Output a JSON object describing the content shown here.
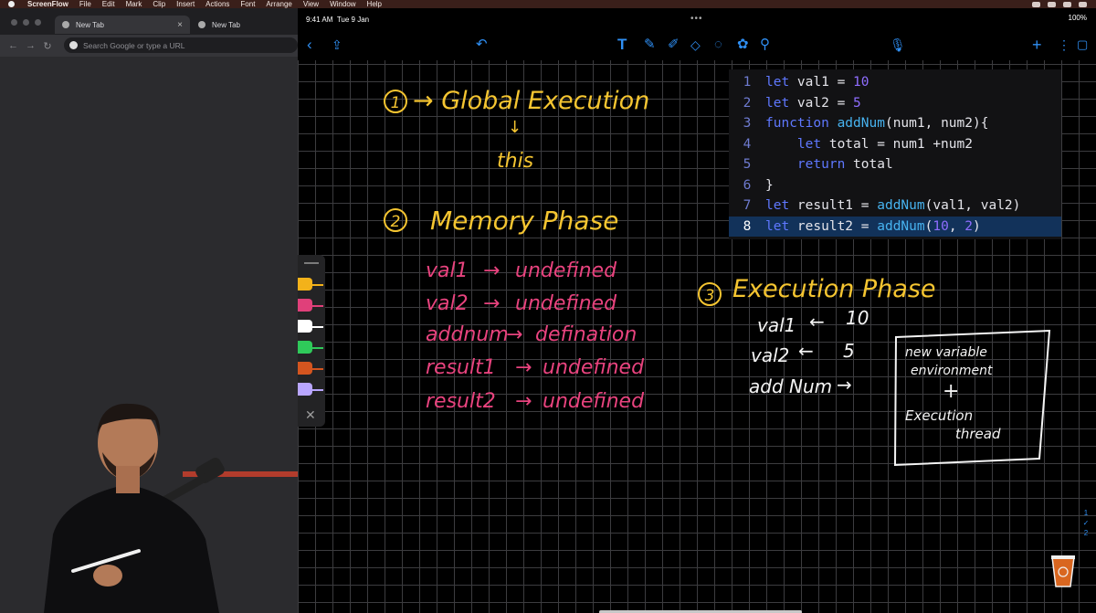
{
  "menubar": {
    "app": "ScreenFlow",
    "items": [
      "File",
      "Edit",
      "Mark",
      "Clip",
      "Insert",
      "Actions",
      "Font",
      "Arrange",
      "View",
      "Window",
      "Help"
    ]
  },
  "browser": {
    "tabs": [
      {
        "label": "New Tab"
      },
      {
        "label": "New Tab"
      }
    ],
    "address_placeholder": "Search Google or type a URL"
  },
  "ipad": {
    "time": "9:41 AM",
    "date": "Tue 9 Jan",
    "battery": "100%",
    "toolbar_icons": [
      "back-icon",
      "share-icon",
      "undo-icon",
      "text-tool-icon",
      "pen-icon",
      "highlighter-icon",
      "eraser-icon",
      "lasso-icon",
      "shapes-icon",
      "color-picker-icon",
      "microphone-icon",
      "add-icon",
      "more-icon",
      "pages-icon"
    ],
    "accent": "#2f8ff4"
  },
  "code": {
    "lines": [
      {
        "n": "1",
        "tokens": [
          [
            "kw",
            "let "
          ],
          [
            "pl",
            "val1 = "
          ],
          [
            "num",
            "10"
          ]
        ]
      },
      {
        "n": "2",
        "tokens": [
          [
            "kw",
            "let "
          ],
          [
            "pl",
            "val2 = "
          ],
          [
            "num",
            "5"
          ]
        ]
      },
      {
        "n": "3",
        "tokens": [
          [
            "kw",
            "function "
          ],
          [
            "fn",
            "addNum"
          ],
          [
            "pl",
            "(num1, num2){"
          ]
        ]
      },
      {
        "n": "4",
        "tokens": [
          [
            "pl",
            "    "
          ],
          [
            "kw",
            "let "
          ],
          [
            "pl",
            "total = num1 +num2"
          ]
        ]
      },
      {
        "n": "5",
        "tokens": [
          [
            "pl",
            "    "
          ],
          [
            "kw",
            "return "
          ],
          [
            "pl",
            "total"
          ]
        ]
      },
      {
        "n": "6",
        "tokens": [
          [
            "pl",
            "}"
          ]
        ]
      },
      {
        "n": "7",
        "tokens": [
          [
            "kw",
            "let "
          ],
          [
            "pl",
            "result1 = "
          ],
          [
            "fn",
            "addNum"
          ],
          [
            "pl",
            "(val1, val2)"
          ]
        ]
      },
      {
        "n": "8",
        "tokens": [
          [
            "kw",
            "let "
          ],
          [
            "pl",
            "result2 = "
          ],
          [
            "fn",
            "addNum"
          ],
          [
            "pl",
            "("
          ],
          [
            "num",
            "10"
          ],
          [
            "pl",
            ", "
          ],
          [
            "num",
            "2"
          ],
          [
            "pl",
            ")"
          ]
        ]
      }
    ],
    "active_line": 8
  },
  "notes": {
    "step1_num": "1",
    "step1_title": "→ Global Execution",
    "step1_arrow": "↓",
    "step1_this": "this",
    "step2_num": "2",
    "step2_title": "Memory Phase",
    "memory": [
      {
        "name": "val1",
        "arrow": "→",
        "value": "undefined"
      },
      {
        "name": "val2",
        "arrow": "→",
        "value": "undefined"
      },
      {
        "name": "addnum",
        "arrow": "→",
        "value": "defination"
      },
      {
        "name": "result1",
        "arrow": "→",
        "value": "undefined"
      },
      {
        "name": "result2",
        "arrow": "→",
        "value": "undefined"
      }
    ],
    "step3_num": "3",
    "step3_title": "Execution Phase",
    "exec": [
      {
        "name": "val1",
        "arrow": "←",
        "value": "10"
      },
      {
        "name": "val2",
        "arrow": "←",
        "value": "5"
      },
      {
        "name": "add Num",
        "arrow": "→",
        "value": ""
      }
    ],
    "box_line1": "new variable",
    "box_line2": "environment",
    "box_plus": "+",
    "box_line3": "Execution",
    "box_line4": "thread"
  },
  "palette": {
    "colors": [
      "#f3b21a",
      "#e0407a",
      "#ffffff",
      "#2fc95a",
      "#d4551f",
      "#b9a6ff"
    ]
  },
  "pagenav": {
    "current": "1",
    "check": "✓",
    "total": "2"
  },
  "colors": {
    "yellow": "#f5c531",
    "pink": "#e8437e",
    "white": "#f4f4f4"
  }
}
